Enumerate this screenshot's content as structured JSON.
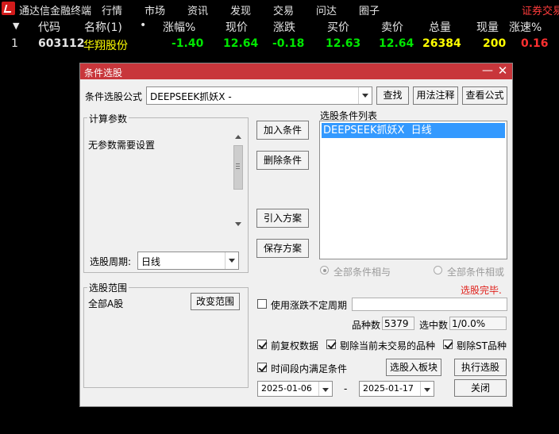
{
  "app": {
    "title": "通达信金融终端",
    "menu": [
      "行情",
      "市场",
      "资讯",
      "发现",
      "交易",
      "问达",
      "圈子"
    ],
    "broker_link": "证券交易"
  },
  "quote_table": {
    "headers": {
      "row_marker": "▼",
      "code": "代码",
      "name": "名称(1)",
      "dot": "•",
      "change_pct": "涨幅%",
      "price": "现价",
      "change": "涨跌",
      "bid": "买价",
      "ask": "卖价",
      "volume": "总量",
      "current_volume": "现量",
      "speed": "涨速%"
    },
    "rows": [
      {
        "index": "1",
        "code": "603112",
        "name": "华翔股份",
        "change_pct": "-1.40",
        "price": "12.64",
        "change": "-0.18",
        "bid": "12.63",
        "ask": "12.64",
        "volume": "26384",
        "current_volume": "200",
        "speed": "0.16"
      }
    ]
  },
  "dialog": {
    "title": "条件选股",
    "formula_label": "条件选股公式",
    "formula_value": "DEEPSEEK抓妖X -",
    "find_button": "查找",
    "usage_button": "用法注释",
    "view_formula_button": "查看公式",
    "calc_params_title": "计算参数",
    "no_params_text": "无参数需要设置",
    "period_label": "选股周期:",
    "period_value": "日线",
    "add_condition_button": "加入条件",
    "delete_condition_button": "删除条件",
    "import_plan_button": "引入方案",
    "save_plan_button": "保存方案",
    "condition_list_title": "选股条件列表",
    "conditions": [
      "DEEPSEEK抓妖X  日线"
    ],
    "logic_and_label": "全部条件相与",
    "logic_or_label": "全部条件相或",
    "status_text": "选股完毕.",
    "range_title": "选股范围",
    "range_value": "全部A股",
    "change_range_button": "改变范围",
    "use_irregular_period_label": "使用涨跌不定周期",
    "irregular_period_value": "",
    "count_label": "品种数",
    "count_value": "5379",
    "selected_label": "选中数",
    "selected_value": "1/0.0%",
    "forward_adjust_label": "前复权数据",
    "exclude_untraded_label": "剔除当前未交易的品种",
    "exclude_st_label": "剔除ST品种",
    "time_range_label": "时间段内满足条件",
    "to_block_button": "选股入板块",
    "run_button": "执行选股",
    "start_date": "2025-01-06",
    "date_separator": "-",
    "end_date": "2025-01-17",
    "close_button": "关闭",
    "colors": {
      "titlebar": "#c8363b",
      "selection": "#3399ff",
      "status_red": "#e0201a"
    }
  }
}
